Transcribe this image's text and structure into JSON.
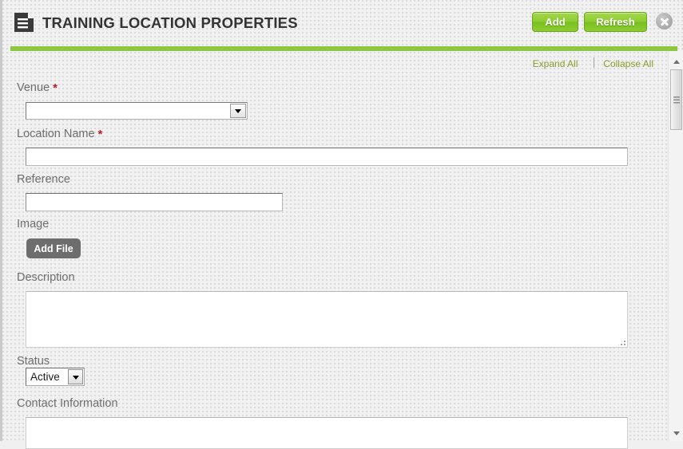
{
  "header": {
    "title": "TRAINING LOCATION PROPERTIES",
    "icon": "document-icon",
    "add_label": "Add",
    "refresh_label": "Refresh",
    "close_icon": "close-circle-icon",
    "accent_color": "#8ec63f"
  },
  "toolbar": {
    "expand_all": "Expand All",
    "collapse_all": "Collapse All",
    "link_color": "#8a9a2b"
  },
  "form": {
    "required_marker": "*",
    "fields": {
      "venue": {
        "label": "Venue",
        "required": true,
        "value": "",
        "placeholder": "",
        "control": "combobox",
        "arrow_icon": "chevron-down-icon"
      },
      "location_name": {
        "label": "Location Name",
        "required": true,
        "value": "",
        "placeholder": "",
        "control": "text"
      },
      "reference": {
        "label": "Reference",
        "required": false,
        "value": "",
        "placeholder": "",
        "control": "text"
      },
      "image": {
        "label": "Image",
        "required": false,
        "button_label": "Add File",
        "control": "file"
      },
      "description": {
        "label": "Description",
        "required": false,
        "value": "",
        "placeholder": "",
        "control": "textarea"
      },
      "status": {
        "label": "Status",
        "required": false,
        "value": "Active",
        "options": [
          "Active"
        ],
        "control": "select",
        "arrow_icon": "chevron-down-icon"
      },
      "contact_information": {
        "label": "Contact Information",
        "required": false,
        "value": "",
        "placeholder": "",
        "control": "textarea"
      }
    }
  },
  "scrollbar": {
    "up_icon": "arrow-up-icon",
    "down_icon": "arrow-down-icon",
    "thumb": "scroll-thumb"
  }
}
